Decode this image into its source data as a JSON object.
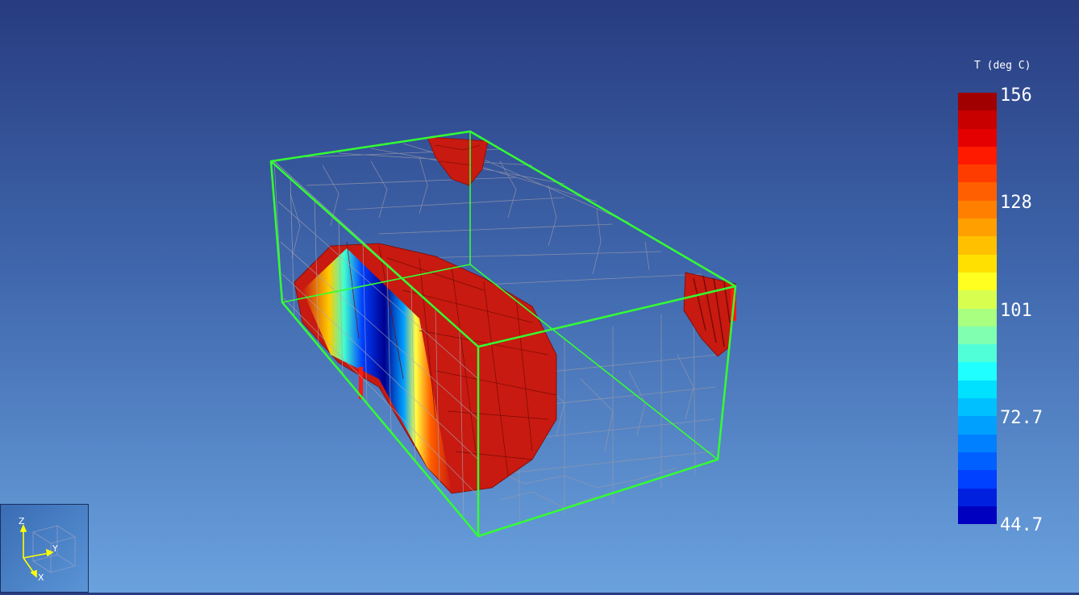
{
  "legend": {
    "title": "T (deg C)",
    "ticks": [
      "156",
      "128",
      "101",
      "72.7",
      "44.7"
    ],
    "tick_values": [
      156,
      128,
      101,
      72.7,
      44.7
    ],
    "range": [
      44.7,
      156
    ],
    "colors": [
      "#a00000",
      "#c80000",
      "#e40000",
      "#ff1a00",
      "#ff3c00",
      "#ff5f00",
      "#ff8000",
      "#ffa000",
      "#ffc000",
      "#ffe000",
      "#ffff20",
      "#d8ff50",
      "#a8ff80",
      "#80ffb0",
      "#50ffd8",
      "#20ffff",
      "#00e0ff",
      "#00c0ff",
      "#00a0ff",
      "#0080ff",
      "#0060ff",
      "#0040ff",
      "#0020e0",
      "#0000c0"
    ]
  },
  "axes_widget": {
    "labels": {
      "z": "Z",
      "y": "Y",
      "x": "X"
    },
    "axis_color": "#ffff00"
  },
  "scene": {
    "box_edge_color": "#33ff33",
    "mesh_color": "#9a9aa8",
    "surface_color": "#cc1111"
  }
}
